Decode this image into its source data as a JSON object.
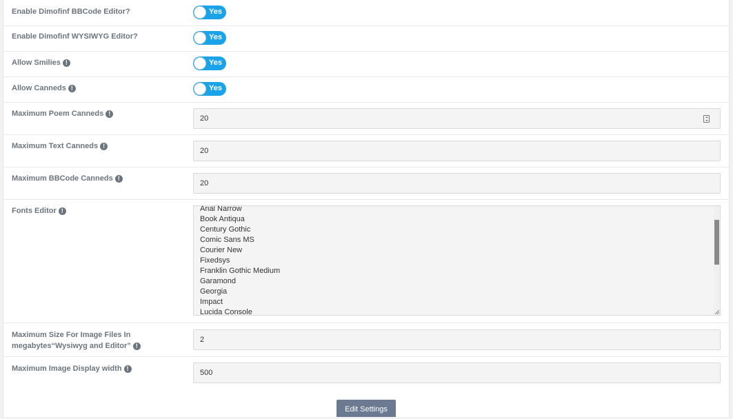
{
  "settings": {
    "bbcode_editor": {
      "label": "Enable Dimofinf BBCode Editor?",
      "value": "Yes"
    },
    "wysiwyg_editor": {
      "label": "Enable Dimofinf WYSIWYG Editor?",
      "value": "Yes"
    },
    "allow_smilies": {
      "label": "Allow Smilies",
      "value": "Yes"
    },
    "allow_canneds": {
      "label": "Allow Canneds",
      "value": "Yes"
    },
    "max_poem_canneds": {
      "label": "Maximum Poem Canneds",
      "value": "20"
    },
    "max_text_canneds": {
      "label": "Maximum Text Canneds",
      "value": "20"
    },
    "max_bbcode_canneds": {
      "label": "Maximum BBCode Canneds",
      "value": "20"
    },
    "fonts_editor": {
      "label": "Fonts Editor",
      "options": [
        "Arial Narrow",
        "Book Antiqua",
        "Century Gothic",
        "Comic Sans MS",
        "Courier New",
        "Fixedsys",
        "Franklin Gothic Medium",
        "Garamond",
        "Georgia",
        "Impact",
        "Lucida Console"
      ]
    },
    "max_image_size": {
      "label": "Maximum Size For Image Files In megabytes“Wysiwyg and Editor”",
      "value": "2"
    },
    "max_image_width": {
      "label": "Maximum Image Display width",
      "value": "500"
    }
  },
  "info_glyph": "!",
  "submit_label": "Edit Settings",
  "colors": {
    "toggle_on": "#1aa3e8",
    "button": "#6c7a91",
    "label": "#6c757d"
  }
}
